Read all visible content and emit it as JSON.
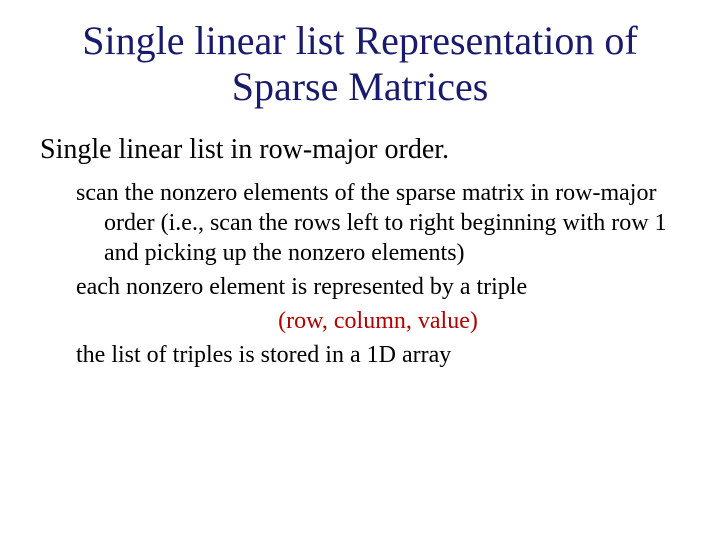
{
  "title": "Single linear list Representation of Sparse Matrices",
  "subtitle": "Single linear list in row-major order.",
  "body": {
    "p1": "scan the nonzero elements of the sparse matrix in row-major order (i.e., scan the rows left to right beginning with row 1 and picking up the nonzero elements)",
    "p2": "each nonzero element is represented by a triple",
    "triple": "(row, column, value)",
    "p3": "the list of triples is stored in a 1D array"
  }
}
